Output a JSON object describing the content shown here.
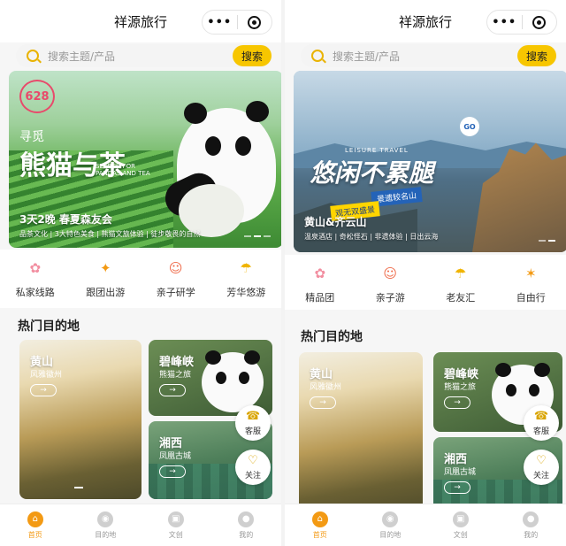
{
  "left": {
    "app_title": "祥源旅行",
    "capsule": {
      "more": "•••"
    },
    "search": {
      "placeholder": "搜索主题/产品",
      "button": "搜索"
    },
    "banner": {
      "badge": "628",
      "kicker": "寻觅",
      "title": "熊猫与茶",
      "subtitle": "SEARCH FOR PANDAS AND TEA",
      "caption": "3天2晚 春夏森友会",
      "caption_sub": "品茶文化 | 3大特色美食 | 熊猫文旅体验 | 徒步敬畏的自然"
    },
    "categories": [
      {
        "label": "私家线路",
        "icon": "route-icon",
        "glyph": "✿",
        "color": "#f28ea0"
      },
      {
        "label": "跟团出游",
        "icon": "group-tour-icon",
        "glyph": "✦",
        "color": "#f39a14"
      },
      {
        "label": "亲子研学",
        "icon": "family-icon",
        "glyph": "☺",
        "color": "#ef6b4a"
      },
      {
        "label": "芳华悠游",
        "icon": "leisure-icon",
        "glyph": "☂",
        "color": "#f0b400"
      }
    ],
    "section_title": "热门目的地",
    "destinations": [
      {
        "name": "黄山",
        "desc": "风雅徽州",
        "arrow": "→"
      },
      {
        "name": "碧峰峡",
        "desc": "熊猫之旅",
        "arrow": "→"
      },
      {
        "name": "湘西",
        "desc": "凤凰古城",
        "arrow": "→"
      }
    ],
    "floats": [
      {
        "label": "客服",
        "glyph": "☎"
      },
      {
        "label": "关注",
        "glyph": "♡"
      }
    ],
    "tabs": [
      {
        "label": "首页",
        "active": true,
        "glyph": "⌂"
      },
      {
        "label": "目的地",
        "active": false,
        "glyph": "◉"
      },
      {
        "label": "文创",
        "active": false,
        "glyph": "▣"
      },
      {
        "label": "我的",
        "active": false,
        "glyph": "●"
      }
    ]
  },
  "right": {
    "app_title": "祥源旅行",
    "capsule": {
      "more": "•••"
    },
    "search": {
      "placeholder": "搜索主题/产品",
      "button": "搜索"
    },
    "banner": {
      "kicker": "LEISURE TRAVEL",
      "title": "悠闲不累腿",
      "tag1": "景遗较名山",
      "tag2": "观无双盛景",
      "go": "GO",
      "caption": "黄山&齐云山",
      "caption_sub": "温泉酒店 | 奇松怪石 | 非遗体验 | 日出云海"
    },
    "categories": [
      {
        "label": "精品团",
        "icon": "premium-tour-icon",
        "glyph": "✿",
        "color": "#f28ea0"
      },
      {
        "label": "亲子游",
        "icon": "family-icon",
        "glyph": "☺",
        "color": "#ef6b4a"
      },
      {
        "label": "老友汇",
        "icon": "friends-icon",
        "glyph": "☂",
        "color": "#f0b400"
      },
      {
        "label": "自由行",
        "icon": "free-travel-icon",
        "glyph": "✶",
        "color": "#f39a14"
      }
    ],
    "section_title": "热门目的地",
    "destinations": [
      {
        "name": "黄山",
        "desc": "风雅徽州",
        "arrow": "→"
      },
      {
        "name": "碧峰峡",
        "desc": "熊猫之旅",
        "arrow": "→"
      },
      {
        "name": "湘西",
        "desc": "凤凰古城",
        "arrow": "→"
      }
    ],
    "floats": [
      {
        "label": "客服",
        "glyph": "☎"
      },
      {
        "label": "关注",
        "glyph": "♡"
      }
    ],
    "tabs": [
      {
        "label": "首页",
        "active": true,
        "glyph": "⌂"
      },
      {
        "label": "目的地",
        "active": false,
        "glyph": "◉"
      },
      {
        "label": "文创",
        "active": false,
        "glyph": "▣"
      },
      {
        "label": "我的",
        "active": false,
        "glyph": "●"
      }
    ]
  }
}
